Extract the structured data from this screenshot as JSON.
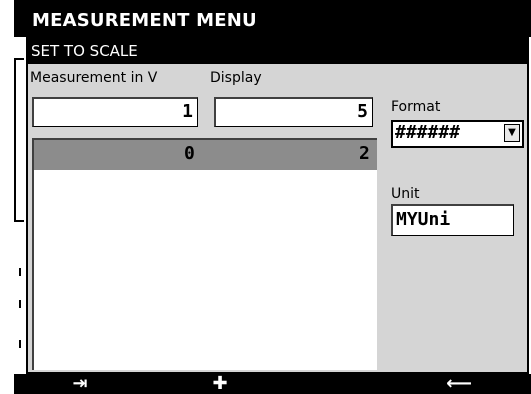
{
  "header": {
    "title": "MEASUREMENT MENU"
  },
  "dialog": {
    "title": "SET TO SCALE",
    "measurement_label": "Measurement in V",
    "display_label": "Display",
    "measurement_value": "1",
    "display_value": "5",
    "table": {
      "selected_row": {
        "measurement": "0",
        "display": "2"
      }
    },
    "format_label": "Format",
    "format_value": "######",
    "unit_label": "Unit",
    "unit_value": "MYUni"
  },
  "softkeys": {
    "tab_icon": "tab-right-icon",
    "plus_icon": "plus-icon",
    "back_icon": "arrow-left-icon",
    "tab_glyph": "⇥",
    "plus_glyph": "✚",
    "back_glyph": "⟵"
  },
  "colors": {
    "bar_bg": "#000000",
    "dialog_bg": "#d5d5d5",
    "selected_row": "#8c8c8c"
  }
}
